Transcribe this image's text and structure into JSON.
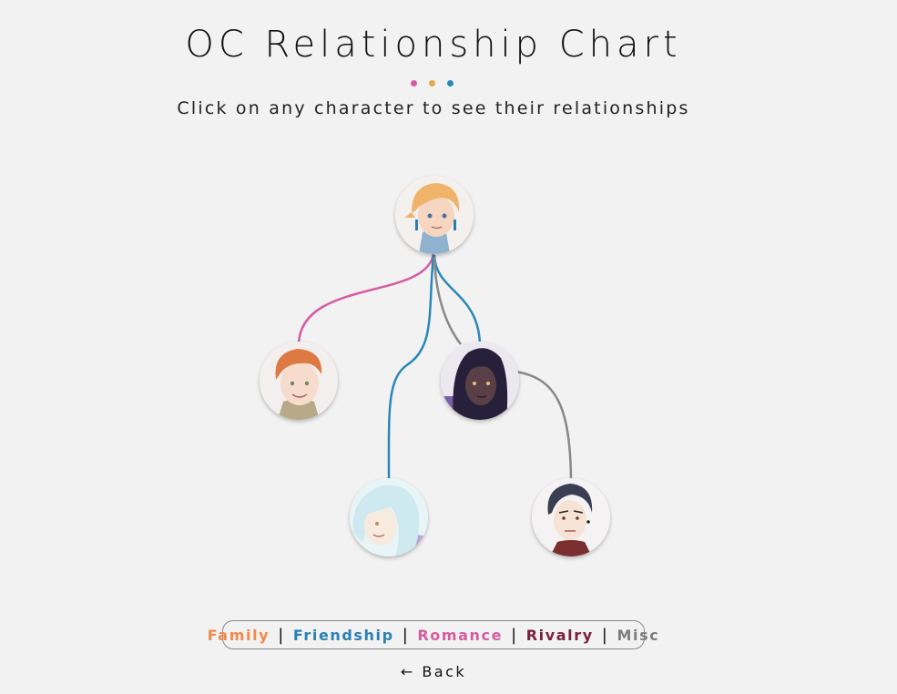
{
  "page": {
    "title": "OC Relationship Chart",
    "subtitle": "Click on any character to see their relationships",
    "back_label": "← Back"
  },
  "accent_dots": [
    "#d65ca2",
    "#e3a84a",
    "#2a88b8"
  ],
  "legend": [
    {
      "label": "Family",
      "color": "#f08a4b"
    },
    {
      "label": "Friendship",
      "color": "#2a7fb3"
    },
    {
      "label": "Romance",
      "color": "#d65ca2"
    },
    {
      "label": "Rivalry",
      "color": "#7a1f3d"
    },
    {
      "label": "Misc",
      "color": "#7d7d7d"
    }
  ],
  "characters": [
    {
      "id": "blonde-elf",
      "hair": "#f0b36a",
      "skin": "#f6d5c1",
      "bg": "#f4f0ee",
      "outfit": "#8fb3cf"
    },
    {
      "id": "ginger",
      "hair": "#dd7a43",
      "skin": "#f7dccd",
      "bg": "#f3efee",
      "outfit": "#b8a989"
    },
    {
      "id": "dark-haired",
      "hair": "#26203a",
      "skin": "#5a3f47",
      "bg": "#ebe9ef",
      "outfit": "#7b5fa6"
    },
    {
      "id": "silver-haired",
      "hair": "#cfe9f0",
      "skin": "#f7eadf",
      "bg": "#e8f5f7",
      "outfit": "#b9a4d4"
    },
    {
      "id": "black-haired",
      "hair": "#3a3e52",
      "skin": "#f7e3d6",
      "bg": "#f4f2f2",
      "outfit": "#7a2e2e"
    }
  ],
  "relationships": [
    {
      "from": "blonde-elf",
      "to": "ginger",
      "type": "Romance",
      "color": "#d65ca2"
    },
    {
      "from": "blonde-elf",
      "to": "silver-haired",
      "type": "Friendship",
      "color": "#2a88b8"
    },
    {
      "from": "blonde-elf",
      "to": "dark-haired",
      "type": "Friendship",
      "color": "#2a88b8"
    },
    {
      "from": "blonde-elf",
      "to": "dark-haired",
      "type": "Misc",
      "color": "#888888"
    },
    {
      "from": "dark-haired",
      "to": "black-haired",
      "type": "Misc",
      "color": "#888888"
    }
  ]
}
